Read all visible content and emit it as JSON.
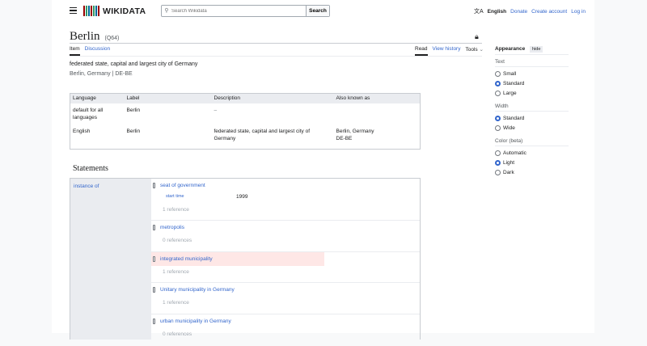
{
  "header": {
    "logo_text": "WIKIDATA",
    "search_placeholder": "Search Wikidata",
    "search_button": "Search",
    "language": "English",
    "donate": "Donate",
    "create_account": "Create account",
    "login": "Log in",
    "logo_colors": [
      "#990000",
      "#339966",
      "#006699",
      "#990000",
      "#339966",
      "#006699",
      "#990000"
    ]
  },
  "title": {
    "label": "Berlin",
    "qid": "(Q64)"
  },
  "tabs": {
    "item": "Item",
    "discussion": "Discussion",
    "read": "Read",
    "view_history": "View history",
    "tools": "Tools"
  },
  "description": "federated state, capital and largest city of Germany",
  "aliases": [
    "Berlin, Germany",
    "DE-BE"
  ],
  "alias_sep": "|",
  "labels_table": {
    "headers": [
      "Language",
      "Label",
      "Description",
      "Also known as"
    ],
    "rows": [
      {
        "language": "default for all languages",
        "label": "Berlin",
        "description": "–",
        "aliases": ""
      },
      {
        "language": "English",
        "label": "Berlin",
        "description": "federated state, capital and largest city of Germany",
        "aliases": "Berlin, Germany\nDE-BE"
      }
    ]
  },
  "statements": {
    "heading": "Statements",
    "property": "instance of",
    "values": [
      {
        "value": "seat of government",
        "qualifier_prop": "start time",
        "qualifier_value": "1999",
        "refs": "1 reference",
        "rank": "normal"
      },
      {
        "value": "metropolis",
        "refs": "0 references",
        "rank": "normal"
      },
      {
        "value": "integrated municipality",
        "refs": "1 reference",
        "rank": "deprecated",
        "highlight": "#fee7e6"
      },
      {
        "value": "Unitary municipality in Germany",
        "refs": "1 reference",
        "rank": "normal"
      },
      {
        "value": "urban municipality in Germany",
        "refs": "0 references",
        "rank": "normal"
      }
    ]
  },
  "appearance": {
    "title": "Appearance",
    "hide": "hide",
    "text": {
      "label": "Text",
      "options": [
        "Small",
        "Standard",
        "Large"
      ],
      "selected": "Standard"
    },
    "width": {
      "label": "Width",
      "options": [
        "Standard",
        "Wide"
      ],
      "selected": "Standard"
    },
    "color": {
      "label": "Color (beta)",
      "options": [
        "Automatic",
        "Light",
        "Dark"
      ],
      "selected": "Light"
    }
  }
}
